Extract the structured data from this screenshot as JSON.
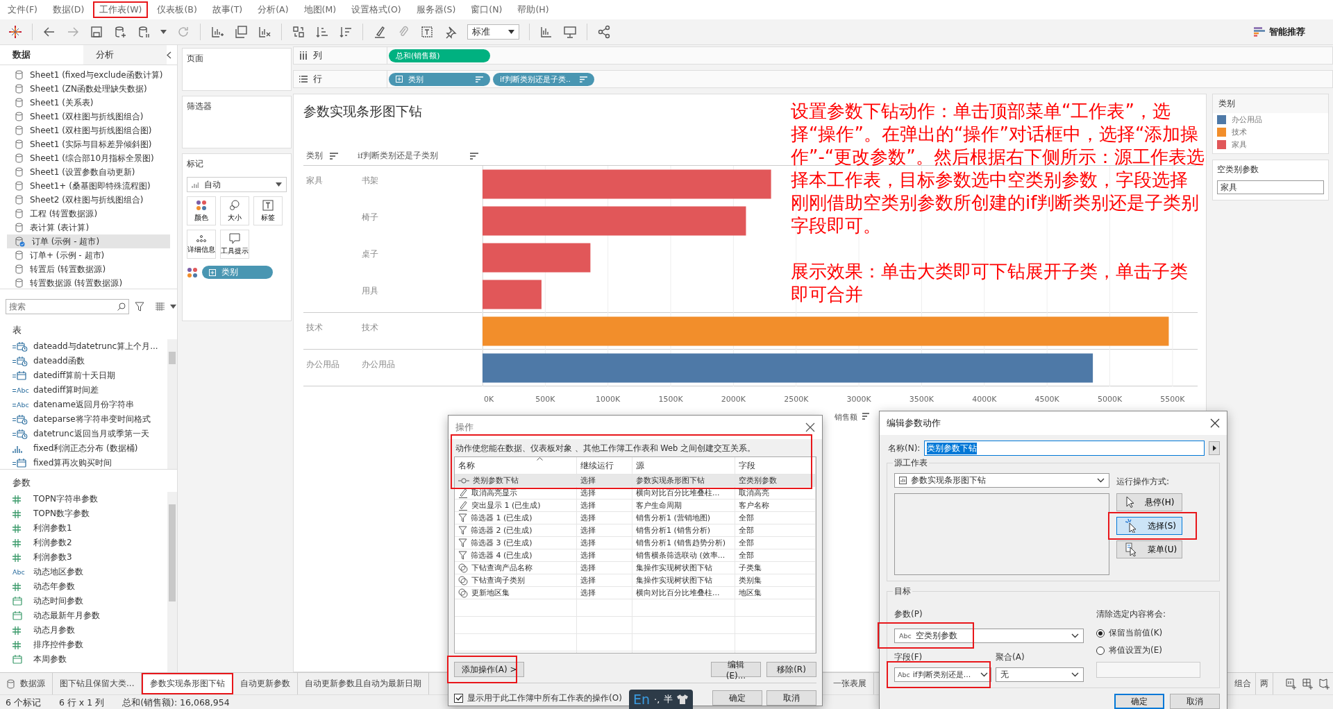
{
  "menu": [
    {
      "label": "文件(F)",
      "highlighted": false
    },
    {
      "label": "数据(D)",
      "highlighted": false
    },
    {
      "label": "工作表(W)",
      "highlighted": true
    },
    {
      "label": "仪表板(B)",
      "highlighted": false
    },
    {
      "label": "故事(T)",
      "highlighted": false
    },
    {
      "label": "分析(A)",
      "highlighted": false
    },
    {
      "label": "地图(M)",
      "highlighted": false
    },
    {
      "label": "设置格式(O)",
      "highlighted": false
    },
    {
      "label": "服务器(S)",
      "highlighted": false
    },
    {
      "label": "窗口(N)",
      "highlighted": false
    },
    {
      "label": "帮助(H)",
      "highlighted": false
    }
  ],
  "toolbar": {
    "fit": "标准",
    "show_me": "智能推荐"
  },
  "left_panel": {
    "tabs": [
      {
        "label": "数据",
        "selected": true
      },
      {
        "label": "分析",
        "selected": false
      }
    ],
    "data_sources": [
      {
        "label": "Sheet1 (fixed与exclude函数计算)",
        "selected": false
      },
      {
        "label": "Sheet1 (ZN函数处理缺失数据)",
        "selected": false
      },
      {
        "label": "Sheet1 (关系表)",
        "selected": false
      },
      {
        "label": "Sheet1 (双柱图与折线图组合)",
        "selected": false
      },
      {
        "label": "Sheet1 (双柱图与折线图组合图)",
        "selected": false
      },
      {
        "label": "Sheet1 (实际与目标差异倾斜图)",
        "selected": false
      },
      {
        "label": "Sheet1 (综合部10月指标全景图)",
        "selected": false
      },
      {
        "label": "Sheet1 (设置参数自动更新)",
        "selected": false
      },
      {
        "label": "Sheet1+ (桑基图即特殊流程图)",
        "selected": false
      },
      {
        "label": "Sheet2 (双柱图与折线图组合)",
        "selected": false
      },
      {
        "label": "工程 (转置数据源)",
        "selected": false
      },
      {
        "label": "表计算 (表计算)",
        "selected": false
      },
      {
        "label": "订单 (示例 - 超市)",
        "selected": true
      },
      {
        "label": "订单+ (示例 - 超市)",
        "selected": false
      },
      {
        "label": "转置后 (转置数据源)",
        "selected": false
      },
      {
        "label": "转置数据源 (转置数据源)",
        "selected": false
      }
    ],
    "search": {
      "placeholder": "搜索"
    },
    "tables_header": "表",
    "fields": [
      {
        "kind": "datetime-calc",
        "label": "dateadd与datetrunc算上个月..."
      },
      {
        "kind": "datetime-calc",
        "label": "dateadd函数"
      },
      {
        "kind": "date-calc",
        "label": "datediff算前十天日期"
      },
      {
        "kind": "string-calc",
        "type_label": "Abc",
        "label": "datediff算时间差"
      },
      {
        "kind": "string-calc",
        "type_label": "Abc",
        "label": "datename返回月份字符串"
      },
      {
        "kind": "datetime-calc",
        "label": "dateparse将字符串变时间格式"
      },
      {
        "kind": "datetime-calc",
        "label": "datetrunc返回当月或季第一天"
      },
      {
        "kind": "bin",
        "label": "fixed利润正态分布 (数据桶)"
      },
      {
        "kind": "date-calc",
        "label": "fixed算再次购买时间"
      }
    ],
    "parameters_header": "参数",
    "parameters": [
      {
        "kind": "number",
        "label": "TOPN字符串参数"
      },
      {
        "kind": "number",
        "label": "TOPN数字参数"
      },
      {
        "kind": "number",
        "label": "利润参数1"
      },
      {
        "kind": "number",
        "label": "利润参数2"
      },
      {
        "kind": "number",
        "label": "利润参数3"
      },
      {
        "kind": "string",
        "type_label": "Abc",
        "label": "动态地区参数"
      },
      {
        "kind": "number",
        "label": "动态年参数"
      },
      {
        "kind": "date",
        "label": "动态时间参数"
      },
      {
        "kind": "date",
        "label": "动态最新年月参数"
      },
      {
        "kind": "number",
        "label": "动态月参数"
      },
      {
        "kind": "number",
        "label": "排序控件参数"
      },
      {
        "kind": "date",
        "label": "本周参数"
      }
    ]
  },
  "cards": {
    "pages": "页面",
    "filters": "筛选器",
    "marks": {
      "title": "标记",
      "mark_type": "自动",
      "buttons": [
        {
          "kind": "color",
          "label": "颜色"
        },
        {
          "kind": "size",
          "label": "大小"
        },
        {
          "kind": "label",
          "label": "标签"
        },
        {
          "kind": "detail",
          "label": "详细信息"
        },
        {
          "kind": "tooltip",
          "label": "工具提示"
        }
      ],
      "pill": "类别"
    }
  },
  "shelves": {
    "columns": {
      "label": "列",
      "pills": [
        {
          "label": "总和(销售额)",
          "kind": "measure",
          "expandable": false,
          "sorted": false
        }
      ]
    },
    "rows": {
      "label": "行",
      "pills": [
        {
          "label": "类别",
          "kind": "dimension",
          "expandable": true,
          "sorted": true
        },
        {
          "label": "if判断类别还是子类..",
          "kind": "dimension",
          "expandable": false,
          "sorted": true
        }
      ]
    }
  },
  "view": {
    "title": "参数实现条形图下钻",
    "headers": [
      "类别",
      "if判断类别还是子类别"
    ],
    "row_groups": [
      "家具",
      "技术",
      "办公用品"
    ],
    "chart_data": {
      "type": "bar",
      "orientation": "horizontal",
      "xlabel": "销售额",
      "categories": [
        "书架",
        "椅子",
        "桌子",
        "用具",
        "技术",
        "办公用品"
      ],
      "series": [
        {
          "color": "#e15759",
          "values": [
            2300,
            2100,
            860,
            470,
            null,
            null
          ]
        },
        {
          "color": "#f28e2b",
          "values": [
            null,
            null,
            null,
            null,
            5470,
            null
          ]
        },
        {
          "color": "#4e79a7",
          "values": [
            null,
            null,
            null,
            null,
            null,
            4865
          ]
        }
      ],
      "grid": true,
      "xlim": [
        0,
        5700
      ],
      "xticks": [
        {
          "value": 0,
          "label": "0K"
        },
        {
          "value": 500,
          "label": "500K"
        },
        {
          "value": 1000,
          "label": "1000K"
        },
        {
          "value": 1500,
          "label": "1500K"
        },
        {
          "value": 2000,
          "label": "2000K"
        },
        {
          "value": 2500,
          "label": "2500K"
        },
        {
          "value": 3000,
          "label": "3000K"
        },
        {
          "value": 3500,
          "label": "3500K"
        },
        {
          "value": 4000,
          "label": "4000K"
        },
        {
          "value": 4500,
          "label": "4500K"
        },
        {
          "value": 5000,
          "label": "5000K"
        },
        {
          "value": 5500,
          "label": "5500K"
        }
      ],
      "stacked": false
    },
    "annotation": [
      "设置参数下钻动作：单击顶部菜单“工作表”，选择“操作”。在弹出的“操作”对话框中，选择“添加操作”-“更改参数”。然后根据右下侧所示：源工作表选择本工作表，目标参数选中空类别参数，字段选择刚刚借助空类别参数所创建的if判断类别还是子类别字段即可。",
      "展示效果：单击大类即可下钻展开子类，单击子类即可合并"
    ]
  },
  "legend": {
    "title": "类别",
    "items": [
      {
        "label": "办公用品",
        "color": "#4e79a7"
      },
      {
        "label": "技术",
        "color": "#f28e2b"
      },
      {
        "label": "家具",
        "color": "#e15759"
      }
    ]
  },
  "parameter_card": {
    "title": "空类别参数",
    "value": "家具"
  },
  "sheet_tabs": {
    "left": [
      {
        "label": "数据源",
        "kind": "datasource",
        "selected": false,
        "highlighted": false
      },
      {
        "label": "图下钻且保留大类...",
        "kind": "sheet",
        "selected": false,
        "highlighted": false
      },
      {
        "label": "参数实现条形图下钻",
        "kind": "sheet",
        "selected": true,
        "highlighted": true
      },
      {
        "label": "自动更新参数",
        "kind": "sheet",
        "selected": false,
        "highlighted": false
      },
      {
        "label": "自动更新参数且自动为最新日期",
        "kind": "sheet",
        "selected": false,
        "highlighted": false
      }
    ],
    "middle": [
      {
        "label": "一张表展",
        "selected": false
      }
    ],
    "right": [
      {
        "label": "组合",
        "selected": false
      },
      {
        "label": "两",
        "selected": false
      }
    ]
  },
  "status_bar": [
    "6 个标记",
    "6 行 x 1 列",
    "总和(销售额): 16,068,954"
  ],
  "actions_dialog": {
    "title": "操作",
    "description": "动作使您能在数据、仪表板对象 、其他工作簿工作表和 Web 之间创建交互关系。",
    "highlighted": true,
    "columns": [
      "名称",
      "继续运行",
      "源",
      "字段"
    ],
    "rows": [
      {
        "kind": "parameter",
        "name": "类别参数下钻",
        "run_on": "选择",
        "source": "参数实现条形图下钻",
        "field": "空类别参数",
        "selected": true
      },
      {
        "kind": "highlight",
        "name": "取消高亮显示",
        "run_on": "选择",
        "source": "横向对比百分比堆叠柱...",
        "field": "取消高亮",
        "selected": false
      },
      {
        "kind": "highlight",
        "name": "突出显示 1 (已生成)",
        "run_on": "选择",
        "source": "客户生命周期",
        "field": "客户名称",
        "selected": false
      },
      {
        "kind": "filter",
        "name": "筛选器 1 (已生成)",
        "run_on": "选择",
        "source": "销售分析1 (营销地图)",
        "field": "全部",
        "selected": false
      },
      {
        "kind": "filter",
        "name": "筛选器 2 (已生成)",
        "run_on": "选择",
        "source": "销售分析1 (销售分析)",
        "field": "全部",
        "selected": false
      },
      {
        "kind": "filter",
        "name": "筛选器 3 (已生成)",
        "run_on": "选择",
        "source": "销售分析1 (销售趋势分析)",
        "field": "全部",
        "selected": false
      },
      {
        "kind": "filter",
        "name": "筛选器 4 (已生成)",
        "run_on": "选择",
        "source": "销售横条筛选联动 (效率...",
        "field": "全部",
        "selected": false
      },
      {
        "kind": "set",
        "name": "下钻查询产品名称",
        "run_on": "选择",
        "source": "集操作实现树状图下钻",
        "field": "子类集",
        "selected": false
      },
      {
        "kind": "set",
        "name": "下钻查询子类别",
        "run_on": "选择",
        "source": "集操作实现树状图下钻",
        "field": "类别集",
        "selected": false
      },
      {
        "kind": "set",
        "name": "更新地区集",
        "run_on": "选择",
        "source": "横向对比百分比堆叠柱...",
        "field": "地区集",
        "selected": false
      }
    ],
    "add_button": {
      "label": "添加操作(A) >",
      "highlighted": true
    },
    "edit_button": "编辑(E)...",
    "remove_button": "移除(R)",
    "show_all": {
      "label": "显示用于此工作簿中所有工作表的操作(O)",
      "checked": true
    },
    "ok": "确定",
    "cancel": "取消"
  },
  "edit_dialog": {
    "title": "编辑参数动作",
    "name_label": "名称(N):",
    "name_value": "类别参数下钻",
    "name_value_selected": true,
    "source_group": "源工作表",
    "source_sheet": "参数实现条形图下钻",
    "run_label": "运行操作方式:",
    "run_buttons": [
      {
        "kind": "hover",
        "label": "悬停(H)",
        "selected": false,
        "highlighted": false
      },
      {
        "kind": "select",
        "label": "选择(S)",
        "selected": true,
        "highlighted": true
      },
      {
        "kind": "menu",
        "label": "菜单(U)",
        "selected": false,
        "highlighted": false
      }
    ],
    "target_group": "目标",
    "parameter_label": "参数(P)",
    "parameter": {
      "type_label": "Abc",
      "value": "空类别参数",
      "highlighted": true
    },
    "field_label": "字段(F)",
    "field": {
      "type_label": "Abc",
      "value": "if判断类别还是...",
      "highlighted": true
    },
    "aggregation_label": "聚合(A)",
    "aggregation": "无",
    "clear_label": "清除选定内容将会:",
    "clear_options": [
      {
        "label": "保留当前值(K)",
        "selected": true
      },
      {
        "label": "将值设置为(E)",
        "selected": false
      }
    ],
    "ok": "确定",
    "cancel": "取消"
  },
  "ime_bar": {
    "mode": "En",
    "punct": "·,",
    "width": "半"
  }
}
